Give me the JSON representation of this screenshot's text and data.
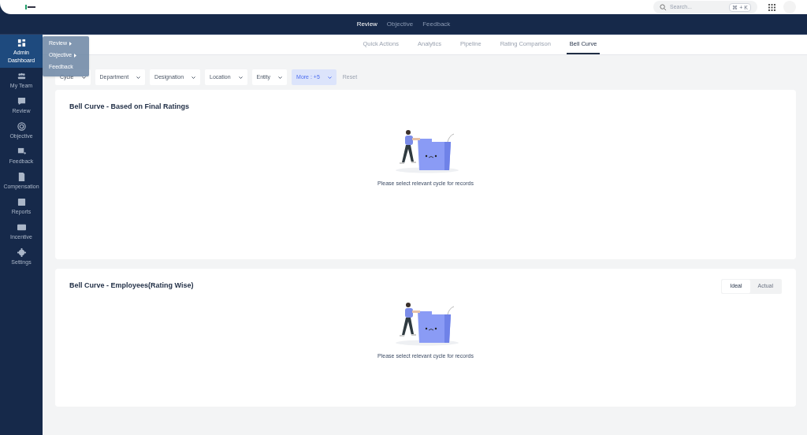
{
  "header": {
    "search": {
      "placeholder": "Search...",
      "shortcut": "⌘ + K"
    }
  },
  "top_nav": [
    {
      "label": "Review",
      "selected": true
    },
    {
      "label": "Objective",
      "selected": false
    },
    {
      "label": "Feedback",
      "selected": false
    }
  ],
  "sidebar": {
    "items": [
      {
        "label": "Admin Dashboard",
        "selected": true
      },
      {
        "label": "My Team",
        "selected": false
      },
      {
        "label": "Review",
        "selected": false
      },
      {
        "label": "Objective",
        "selected": false
      },
      {
        "label": "Feedback",
        "selected": false
      },
      {
        "label": "Compensation",
        "selected": false
      },
      {
        "label": "Reports",
        "selected": false
      },
      {
        "label": "Incentive",
        "selected": false
      },
      {
        "label": "Settings",
        "selected": false
      }
    ]
  },
  "flyout_menu": [
    {
      "label": "Review",
      "has_submenu": true
    },
    {
      "label": "Objective",
      "has_submenu": true
    },
    {
      "label": "Feedback",
      "has_submenu": false
    }
  ],
  "tabs": [
    {
      "label": "Quick Actions",
      "selected": false
    },
    {
      "label": "Analytics",
      "selected": false
    },
    {
      "label": "Pipeline",
      "selected": false
    },
    {
      "label": "Rating Comparison",
      "selected": false
    },
    {
      "label": "Bell Curve",
      "selected": true
    }
  ],
  "filters": [
    {
      "kind": "select",
      "label": "Cycle"
    },
    {
      "kind": "select",
      "label": "Department"
    },
    {
      "kind": "select",
      "label": "Designation"
    },
    {
      "kind": "select",
      "label": "Location"
    },
    {
      "kind": "select",
      "label": "Entity"
    },
    {
      "kind": "more",
      "label": "More : +5"
    },
    {
      "kind": "reset",
      "label": "Reset"
    }
  ],
  "cards": [
    {
      "title": "Bell Curve - Based on Final Ratings",
      "message": "Please select relevant cycle for records"
    },
    {
      "title": "Bell Curve - Employees(Rating Wise)",
      "message": "Please select relevant cycle for records",
      "toggle": [
        {
          "label": "Ideal",
          "selected": true
        },
        {
          "label": "Actual",
          "selected": false
        }
      ]
    }
  ]
}
